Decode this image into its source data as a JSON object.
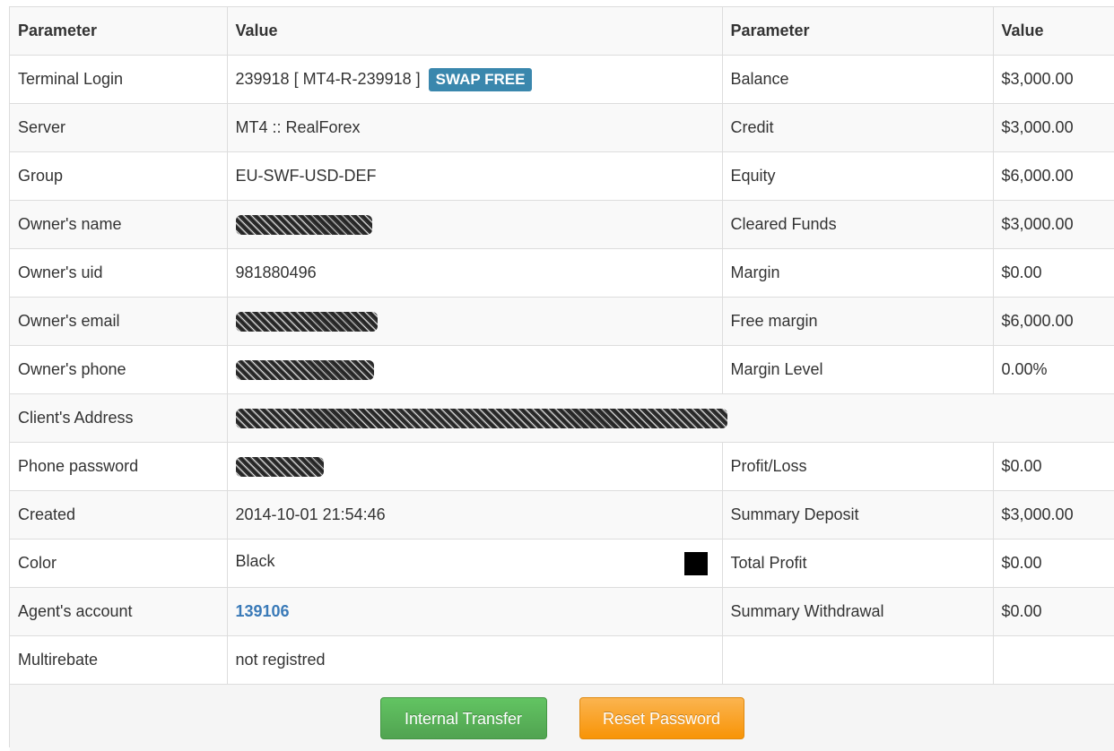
{
  "table": {
    "headers": [
      "Parameter",
      "Value",
      "Parameter",
      "Value"
    ],
    "rows": [
      {
        "p1": "Terminal Login",
        "v1": "239918 [ MT4-R-239918 ]",
        "badge": "SWAP FREE",
        "p2": "Balance",
        "v2": "$3,000.00"
      },
      {
        "p1": "Server",
        "v1": "MT4 :: RealForex",
        "p2": "Credit",
        "v2": "$3,000.00"
      },
      {
        "p1": "Group",
        "v1": "EU-SWF-USD-DEF",
        "p2": "Equity",
        "v2": "$6,000.00"
      },
      {
        "p1": "Owner's name",
        "v1": "",
        "p2": "Cleared Funds",
        "v2": "$3,000.00"
      },
      {
        "p1": "Owner's uid",
        "v1": "981880496",
        "p2": "Margin",
        "v2": "$0.00"
      },
      {
        "p1": "Owner's email",
        "v1": "",
        "p2": "Free margin",
        "v2": "$6,000.00"
      },
      {
        "p1": "Owner's phone",
        "v1": "",
        "p2": "Margin Level",
        "v2": "0.00%"
      },
      {
        "p1": "Client's Address",
        "v1": ""
      },
      {
        "p1": "Phone password",
        "v1": "",
        "p2": "Profit/Loss",
        "v2": "$0.00"
      },
      {
        "p1": "Created",
        "v1": "2014-10-01 21:54:46",
        "p2": "Summary Deposit",
        "v2": "$3,000.00"
      },
      {
        "p1": "Color",
        "v1": "Black",
        "p2": "Total Profit",
        "v2": "$0.00"
      },
      {
        "p1": "Agent's account",
        "v1": "139106",
        "p2": "Summary Withdrawal",
        "v2": "$0.00"
      },
      {
        "p1": "Multirebate",
        "v1": "not registred",
        "p2": "",
        "v2": ""
      }
    ]
  },
  "colors": {
    "badge": "#3a87ad",
    "link": "#3a7ab8",
    "color_swatch": "#000000",
    "internal_transfer_button": "#5bb75b",
    "reset_password_button": "#faa732"
  },
  "buttons": {
    "internal_transfer": "Internal Transfer",
    "reset_password": "Reset Password"
  }
}
